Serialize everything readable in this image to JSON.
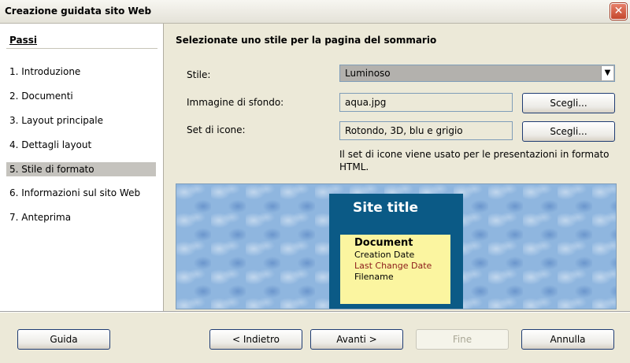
{
  "window": {
    "title": "Creazione guidata sito Web",
    "close_label": "✕"
  },
  "sidebar": {
    "heading": "Passi",
    "steps": [
      "1. Introduzione",
      "2. Documenti",
      "3. Layout principale",
      "4. Dettagli layout",
      "5. Stile di formato",
      "6. Informazioni sul sito Web",
      "7. Anteprima"
    ],
    "active_index": 4
  },
  "main": {
    "heading": "Selezionate uno stile per la pagina del sommario",
    "style": {
      "label": "Stile:",
      "value": "Luminoso"
    },
    "background": {
      "label": "Immagine di sfondo:",
      "value": "aqua.jpg",
      "button": "Scegli..."
    },
    "icons": {
      "label": "Set di icone:",
      "value": "Rotondo, 3D, blu e grigio",
      "button": "Scegli..."
    },
    "note": "Il set di icone viene usato per le presentazioni in formato HTML.",
    "preview": {
      "site_title": "Site title",
      "doc_title": "Document",
      "creation_date": "Creation Date",
      "last_change": "Last Change Date",
      "filename": "Filename"
    }
  },
  "footer": {
    "help": "Guida",
    "back": "< Indietro",
    "next": "Avanti >",
    "finish": "Fine",
    "cancel": "Annulla"
  }
}
